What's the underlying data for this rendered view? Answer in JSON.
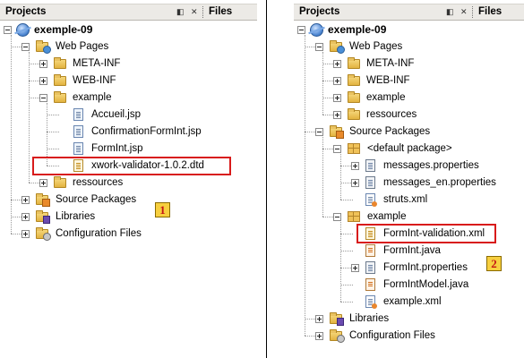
{
  "left": {
    "header": {
      "projects_tab": "Projects",
      "files_tab": "Files"
    },
    "tree": {
      "project": "exemple-09",
      "web_pages": "Web Pages",
      "meta_inf": "META-INF",
      "web_inf": "WEB-INF",
      "example": "example",
      "accueil": "Accueil.jsp",
      "confirmation": "ConfirmationFormInt.jsp",
      "formint": "FormInt.jsp",
      "dtd": "xwork-validator-1.0.2.dtd",
      "ressources": "ressources",
      "source_packages": "Source Packages",
      "libraries": "Libraries",
      "config_files": "Configuration Files"
    },
    "badge": "1"
  },
  "right": {
    "header": {
      "projects_tab": "Projects",
      "files_tab": "Files"
    },
    "tree": {
      "project": "exemple-09",
      "web_pages": "Web Pages",
      "meta_inf": "META-INF",
      "web_inf": "WEB-INF",
      "example": "example",
      "ressources": "ressources",
      "source_packages": "Source Packages",
      "default_package": "<default package>",
      "messages_props": "messages.properties",
      "messages_en_props": "messages_en.properties",
      "struts_xml": "struts.xml",
      "example_pkg": "example",
      "validation_xml": "FormInt-validation.xml",
      "formint_java": "FormInt.java",
      "formint_props": "FormInt.properties",
      "formint_model": "FormIntModel.java",
      "example_xml": "example.xml",
      "libraries": "Libraries",
      "config_files": "Configuration Files"
    },
    "badge": "2"
  },
  "colors": {
    "highlight": "#d81b1b",
    "badge_fill": "#f7cf3f",
    "badge_text": "#c41515",
    "header_bg": "#eceae6"
  }
}
